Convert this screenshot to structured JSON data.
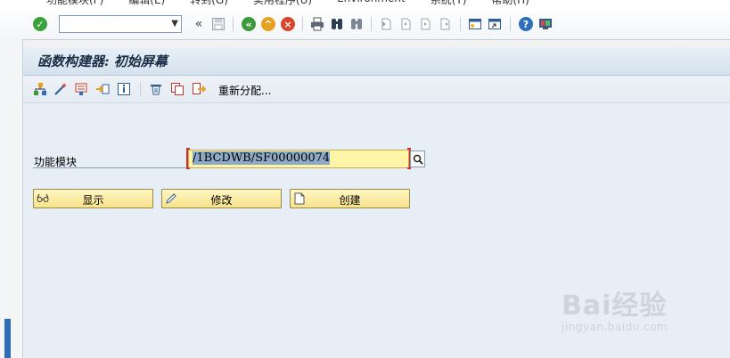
{
  "menubar": {
    "items": [
      "功能模块(F)",
      "编辑(E)",
      "转到(G)",
      "实用程序(U)",
      "Environment",
      "系统(Y)",
      "帮助(H)"
    ]
  },
  "stdtoolbar": {
    "command_value": "",
    "icons": [
      "check-icon",
      "save-icon",
      "back-icon",
      "exit-icon",
      "cancel-icon",
      "print-icon",
      "find-icon",
      "find-next-icon",
      "first-page-icon",
      "prev-page-icon",
      "next-page-icon",
      "last-page-icon",
      "new-session-icon",
      "shortcut-icon",
      "help-icon",
      "layout-icon"
    ]
  },
  "title": "函数构建器: 初始屏幕",
  "apptoolbar": {
    "redistribute_label": "重新分配..."
  },
  "form": {
    "field_label": "功能模块",
    "field_value": "/1BCDWB/SF00000074"
  },
  "buttons": {
    "display": "显示",
    "change": "修改",
    "create": "创建"
  },
  "watermark": {
    "brand": "Bai经验",
    "url": "jingyan.baidu.com"
  },
  "colors": {
    "field_bg": "#fff5a8",
    "button_bg": "#f7e38a",
    "title_bg": "#d4e1ee",
    "main_bg": "#e7eef5"
  }
}
